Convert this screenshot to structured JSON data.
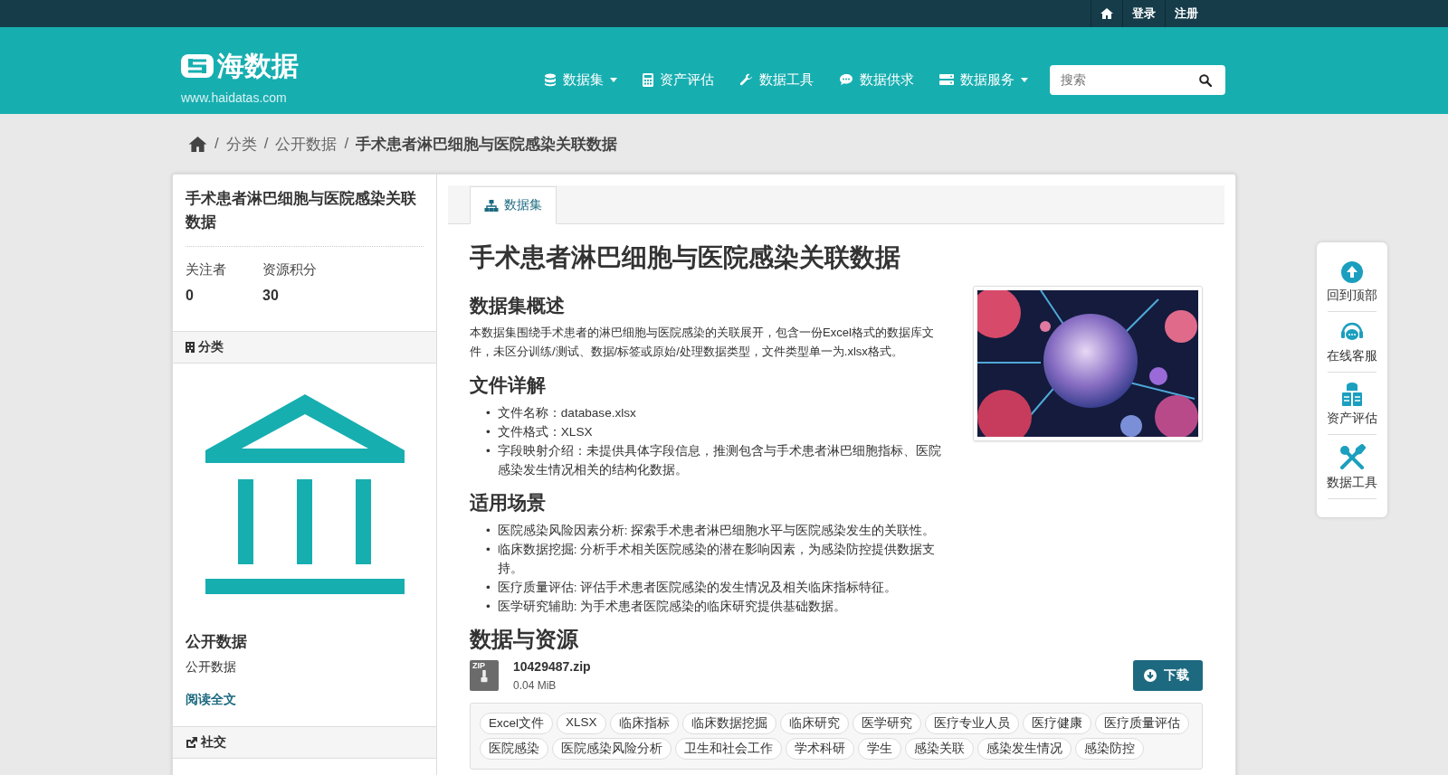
{
  "topbar": {
    "links": [
      "登录",
      "注册"
    ]
  },
  "header": {
    "logo": "海数据",
    "url": "www.haidatas.com",
    "nav": [
      {
        "label": "数据集",
        "kind": "database",
        "dropdown": true
      },
      {
        "label": "资产评估",
        "kind": "calculator",
        "dropdown": false
      },
      {
        "label": "数据工具",
        "kind": "wrench",
        "dropdown": false
      },
      {
        "label": "数据供求",
        "kind": "comment",
        "dropdown": false
      },
      {
        "label": "数据服务",
        "kind": "server",
        "dropdown": true
      }
    ],
    "search": {
      "placeholder": "搜索"
    }
  },
  "breadcrumb": [
    {
      "separator": "/",
      "label": "分类"
    },
    {
      "separator": "/",
      "label": "公开数据"
    },
    {
      "separator": "/",
      "label": "手术患者淋巴细胞与医院感染关联数据"
    }
  ],
  "sidebar": {
    "title": "手术患者淋巴细胞与医院感染关联数据",
    "stats": [
      {
        "label": "关注者",
        "value": "0"
      },
      {
        "label": "资源积分",
        "value": "30"
      }
    ],
    "category_heading": "分类",
    "category_name": "公开数据",
    "category_desc": "公开数据",
    "read_more": "阅读全文",
    "social_heading": "社交"
  },
  "tabs": [
    {
      "label": "数据集",
      "selected": true
    }
  ],
  "content": {
    "title": "手术患者淋巴细胞与医院感染关联数据",
    "overview_heading": "数据集概述",
    "overview": "本数据集围绕手术患者的淋巴细胞与医院感染的关联展开，包含一份Excel格式的数据库文件，未区分训练/测试、数据/标签或原始/处理数据类型，文件类型单一为.xlsx格式。",
    "details_heading": "文件详解",
    "details": [
      {
        "bullet": "•",
        "text": "文件名称：database.xlsx"
      },
      {
        "bullet": "•",
        "text": "文件格式：XLSX"
      },
      {
        "bullet": "•",
        "text": "字段映射介绍：未提供具体字段信息，推测包含与手术患者淋巴细胞指标、医院感染发生情况相关的结构化数据。"
      }
    ],
    "scenarios_heading": "适用场景",
    "scenarios": [
      {
        "bullet": "•",
        "text": "医院感染风险因素分析: 探索手术患者淋巴细胞水平与医院感染发生的关联性。"
      },
      {
        "bullet": "•",
        "text": "临床数据挖掘: 分析手术相关医院感染的潜在影响因素，为感染防控提供数据支持。"
      },
      {
        "bullet": "•",
        "text": "医疗质量评估: 评估手术患者医院感染的发生情况及相关临床指标特征。"
      },
      {
        "bullet": "•",
        "text": "医学研究辅助: 为手术患者医院感染的临床研究提供基础数据。"
      }
    ],
    "resources_heading": "数据与资源",
    "resource": {
      "badge": "ZIP",
      "name": "10429487.zip",
      "size": "0.04 MiB",
      "button": "下载"
    },
    "tags": [
      "Excel文件",
      "XLSX",
      "临床指标",
      "临床数据挖掘",
      "临床研究",
      "医学研究",
      "医疗专业人员",
      "医疗健康",
      "医疗质量评估",
      "医院感染",
      "医院感染风险分析",
      "卫生和社会工作",
      "学术科研",
      "学生",
      "感染关联",
      "感染发生情况",
      "感染防控"
    ]
  },
  "float_panel": [
    {
      "label": "回到顶部",
      "kind": "up"
    },
    {
      "label": "在线客服",
      "kind": "chat"
    },
    {
      "label": "资产评估",
      "kind": "stack"
    },
    {
      "label": "数据工具",
      "kind": "tools"
    }
  ]
}
